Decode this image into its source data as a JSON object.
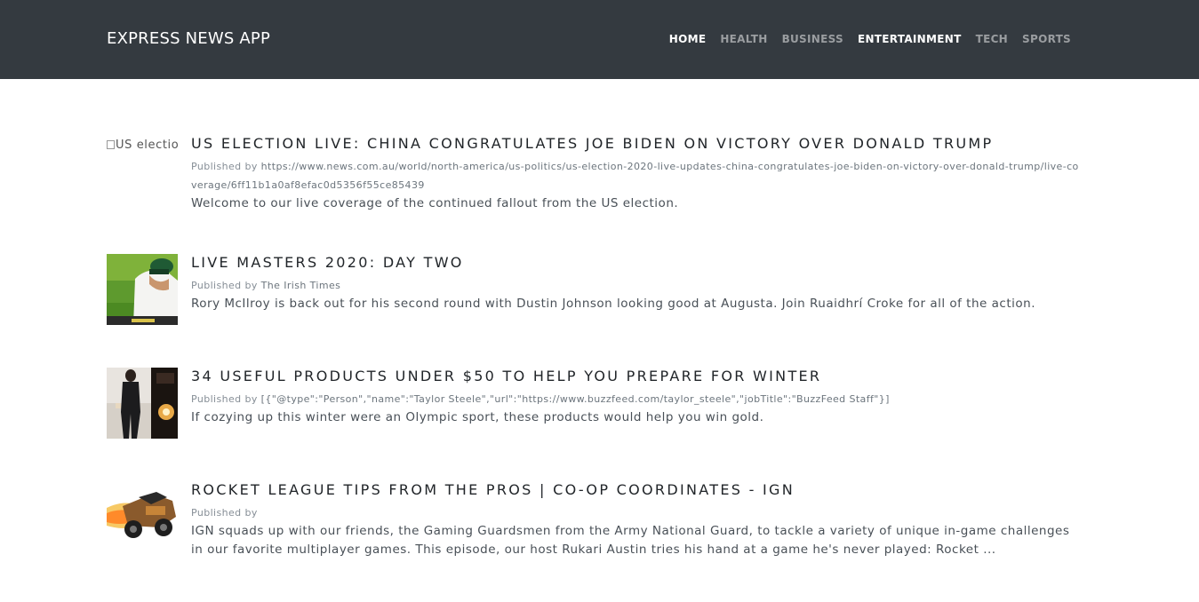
{
  "navbar": {
    "brand": "EXPRESS NEWS APP",
    "links": [
      {
        "label": "HOME"
      },
      {
        "label": "HEALTH"
      },
      {
        "label": "BUSINESS"
      },
      {
        "label": "ENTERTAINMENT"
      },
      {
        "label": "TECH"
      },
      {
        "label": "SPORTS"
      }
    ]
  },
  "articles": [
    {
      "title": "US ELECTION LIVE: CHINA CONGRATULATES JOE BIDEN ON VICTORY OVER DONALD TRUMP",
      "published_by_label": "Published by",
      "author": "https://www.news.com.au/world/north-america/us-politics/us-election-2020-live-updates-china-congratulates-joe-biden-on-victory-over-donald-trump/live-coverage/6ff11b1a0af8efac0d5356f55ce85439",
      "description": "Welcome to our live coverage of the continued fallout from the US election.",
      "image_alt": "US election live: China congratulates Joe Biden o"
    },
    {
      "title": "LIVE MASTERS 2020: DAY TWO",
      "published_by_label": "Published by",
      "author": "The Irish Times",
      "description": "Rory McIlroy is back out for his second round with Dustin Johnson looking good at Augusta. Join Ruaidhrí Croke for all of the action."
    },
    {
      "title": "34 USEFUL PRODUCTS UNDER $50 TO HELP YOU PREPARE FOR WINTER",
      "published_by_label": "Published by",
      "author": "[{\"@type\":\"Person\",\"name\":\"Taylor Steele\",\"url\":\"https://www.buzzfeed.com/taylor_steele\",\"jobTitle\":\"BuzzFeed Staff\"}]",
      "description": "If cozying up this winter were an Olympic sport, these products would help you win gold."
    },
    {
      "title": "ROCKET LEAGUE TIPS FROM THE PROS | CO-OP COORDINATES - IGN",
      "published_by_label": "Published by",
      "author": "",
      "description": "IGN squads up with our friends, the Gaming Guardsmen from the Army National Guard, to tackle a variety of unique in-game challenges in our favorite multiplayer games. This episode, our host Rukari Austin tries his hand at a game he's never played: Rocket ..."
    }
  ],
  "colors": {
    "navbar_bg": "#343a40",
    "nav_active": "#ffffff",
    "nav_inactive": "#9a9da0",
    "title_text": "#212529",
    "body_text": "#495057"
  }
}
